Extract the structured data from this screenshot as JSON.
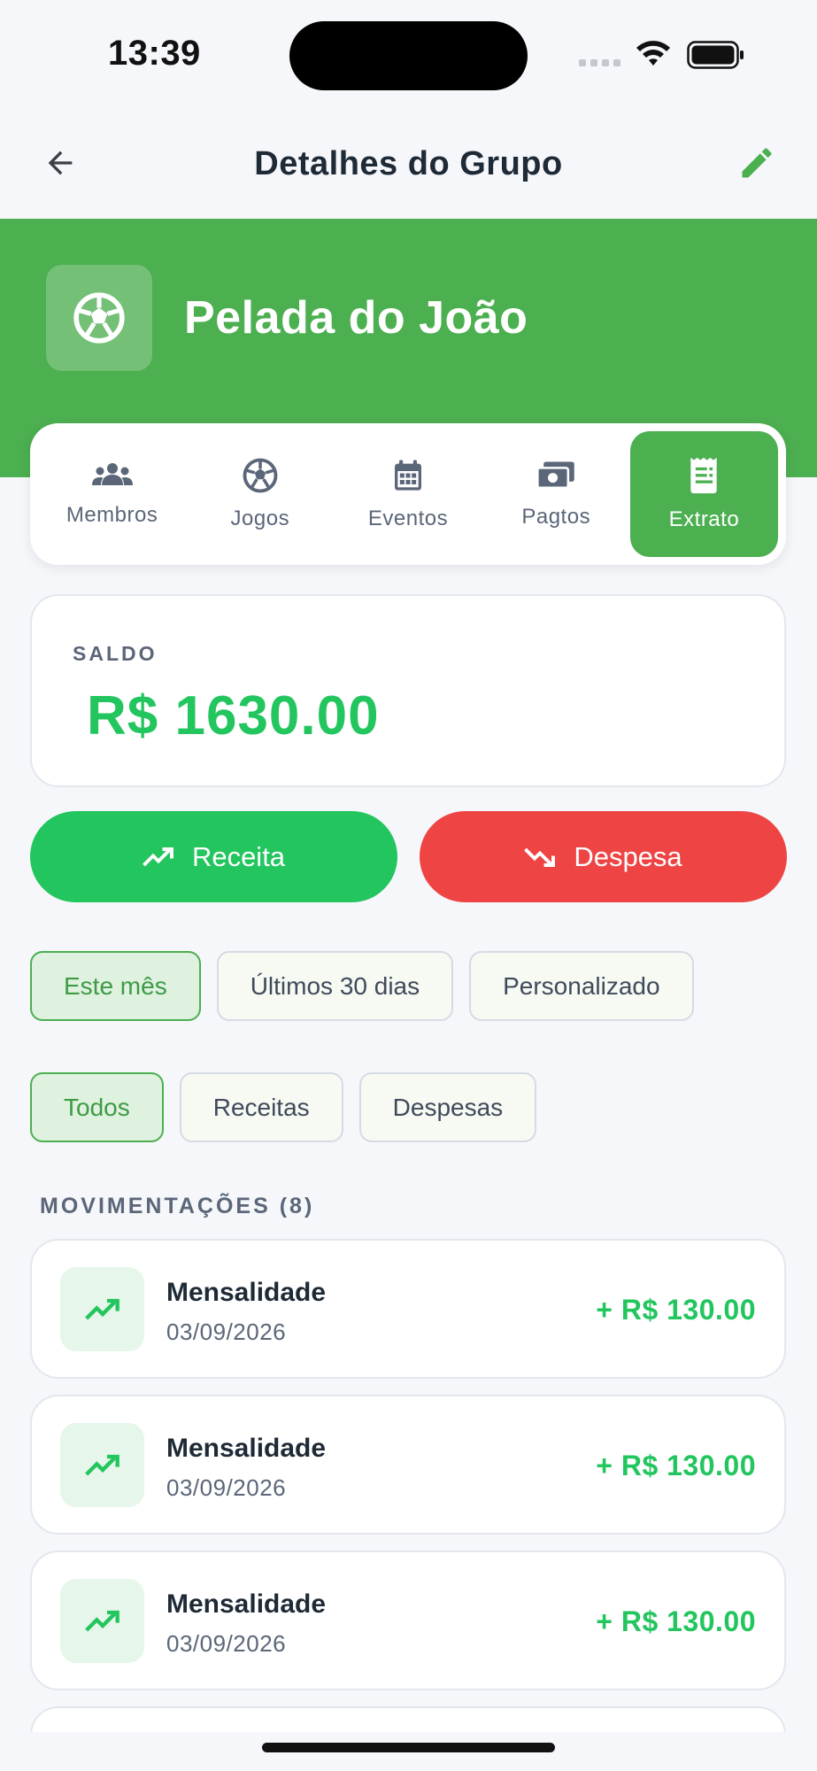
{
  "status_bar": {
    "time": "13:39"
  },
  "header": {
    "title": "Detalhes do Grupo",
    "back_icon": "arrow-left-icon",
    "edit_icon": "pencil-icon"
  },
  "group": {
    "name": "Pelada do João",
    "icon": "soccer-ball-icon"
  },
  "tabs": [
    {
      "label": "Membros",
      "icon": "users-icon",
      "active": false
    },
    {
      "label": "Jogos",
      "icon": "soccer-ball-icon",
      "active": false
    },
    {
      "label": "Eventos",
      "icon": "calendar-icon",
      "active": false
    },
    {
      "label": "Pagtos",
      "icon": "money-icon",
      "active": false
    },
    {
      "label": "Extrato",
      "icon": "receipt-icon",
      "active": true
    }
  ],
  "balance": {
    "label": "SALDO",
    "value": "R$ 1630.00"
  },
  "actions": {
    "income_label": "Receita",
    "expense_label": "Despesa"
  },
  "period_filters": [
    {
      "label": "Este mês",
      "active": true
    },
    {
      "label": "Últimos 30 dias",
      "active": false
    },
    {
      "label": "Personalizado",
      "active": false
    }
  ],
  "type_filters": [
    {
      "label": "Todos",
      "active": true
    },
    {
      "label": "Receitas",
      "active": false
    },
    {
      "label": "Despesas",
      "active": false
    }
  ],
  "movements": {
    "title": "MOVIMENTAÇÕES (8)",
    "items": [
      {
        "name": "Mensalidade",
        "date": "03/09/2026",
        "amount": "+ R$ 130.00",
        "icon": "trending-up-icon"
      },
      {
        "name": "Mensalidade",
        "date": "03/09/2026",
        "amount": "+ R$ 130.00",
        "icon": "trending-up-icon"
      },
      {
        "name": "Mensalidade",
        "date": "03/09/2026",
        "amount": "+ R$ 130.00",
        "icon": "trending-up-icon"
      },
      {
        "name": "",
        "date": "",
        "amount": "",
        "icon": ""
      }
    ]
  },
  "colors": {
    "primary_green": "#4caf50",
    "income_green": "#22c55e",
    "expense_red": "#ef4444"
  }
}
